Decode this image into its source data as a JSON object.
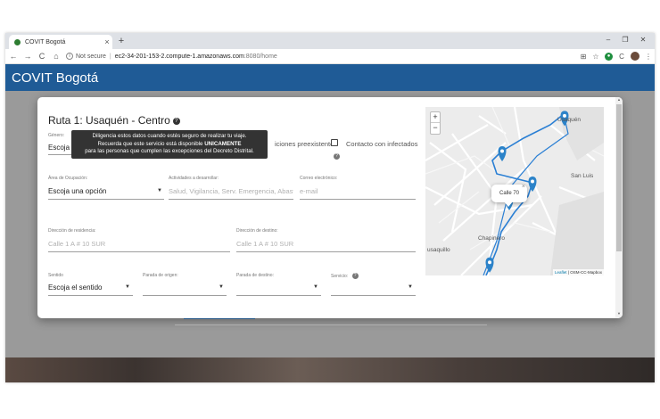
{
  "browser": {
    "tab_title": "COVIT Bogotá",
    "tab_close": "×",
    "new_tab": "+",
    "win_min": "–",
    "win_max": "❐",
    "win_close": "✕",
    "back": "←",
    "forward": "→",
    "reload": "C",
    "home": "⌂",
    "security_label": "Not secure",
    "url_host": "ec2-34-201-153-2.compute-1.amazonaws.com",
    "url_path": ":8080/home",
    "translate_icon": "⊞",
    "star_icon": "☆",
    "ext_icon": "●",
    "ext2_icon": "C",
    "menu_icon": "⋮"
  },
  "app": {
    "title": "COVIT Bogotá"
  },
  "modal": {
    "title": "Ruta 1: Usaquén - Centro",
    "help": "?",
    "genero_label": "Género:",
    "genero_value": "Escoja u",
    "tooltip_line1": "Diligencia estos datos cuando estés seguro de realizar tu viaje.",
    "tooltip_line2_a": "Recuerda que este servicio está disponible ",
    "tooltip_line2_b": "UNICAMENTE",
    "tooltip_line3": "para las personas que cumplen las excepciones del Decreto Distrital.",
    "condiciones_label": "iciones preexistentes",
    "contacto_label": "Contacto con infectados",
    "area_label": "Área de Ocupación:",
    "area_value": "Escoja una opción",
    "actividades_label": "Actividades a desarrollar:",
    "actividades_placeholder": "Salud, Vigilancia, Serv. Emergencia, Abaste",
    "correo_label": "Correo electrónico:",
    "correo_placeholder": "e-mail",
    "residencia_label": "Dirección de residencia:",
    "residencia_placeholder": "Calle 1 A # 10 SUR",
    "destino_label": "Dirección de destino:",
    "destino_placeholder": "Calle 1 A # 10 SUR",
    "sentido_label": "Sentido",
    "sentido_value": "Escoja el sentido",
    "parada_origen_label": "Parada de origen:",
    "parada_destino_label": "Parada de destino:",
    "servicio_label": "Servicio:",
    "caret": "▼"
  },
  "map": {
    "zoom_in": "+",
    "zoom_out": "−",
    "label_usaquen": "Usaquén",
    "label_sanluis": "San Luis",
    "label_chapinero": "Chapinero",
    "label_usaquillo": "usaquillo",
    "popup_text": "Calle 70",
    "popup_close": "×",
    "attribution_leaflet": "Leaflet",
    "attribution_rest": " | OSM-CC-Mapbox",
    "route_color": "#2a7fd4",
    "marker_color": "#2c83c9",
    "markers": [
      {
        "lat_rel": 0.06,
        "lng_rel": 0.78
      },
      {
        "lat_rel": 0.27,
        "lng_rel": 0.43
      },
      {
        "lat_rel": 0.45,
        "lng_rel": 0.6
      },
      {
        "lat_rel": 0.56,
        "lng_rel": 0.47
      },
      {
        "lat_rel": 0.93,
        "lng_rel": 0.36
      }
    ]
  }
}
